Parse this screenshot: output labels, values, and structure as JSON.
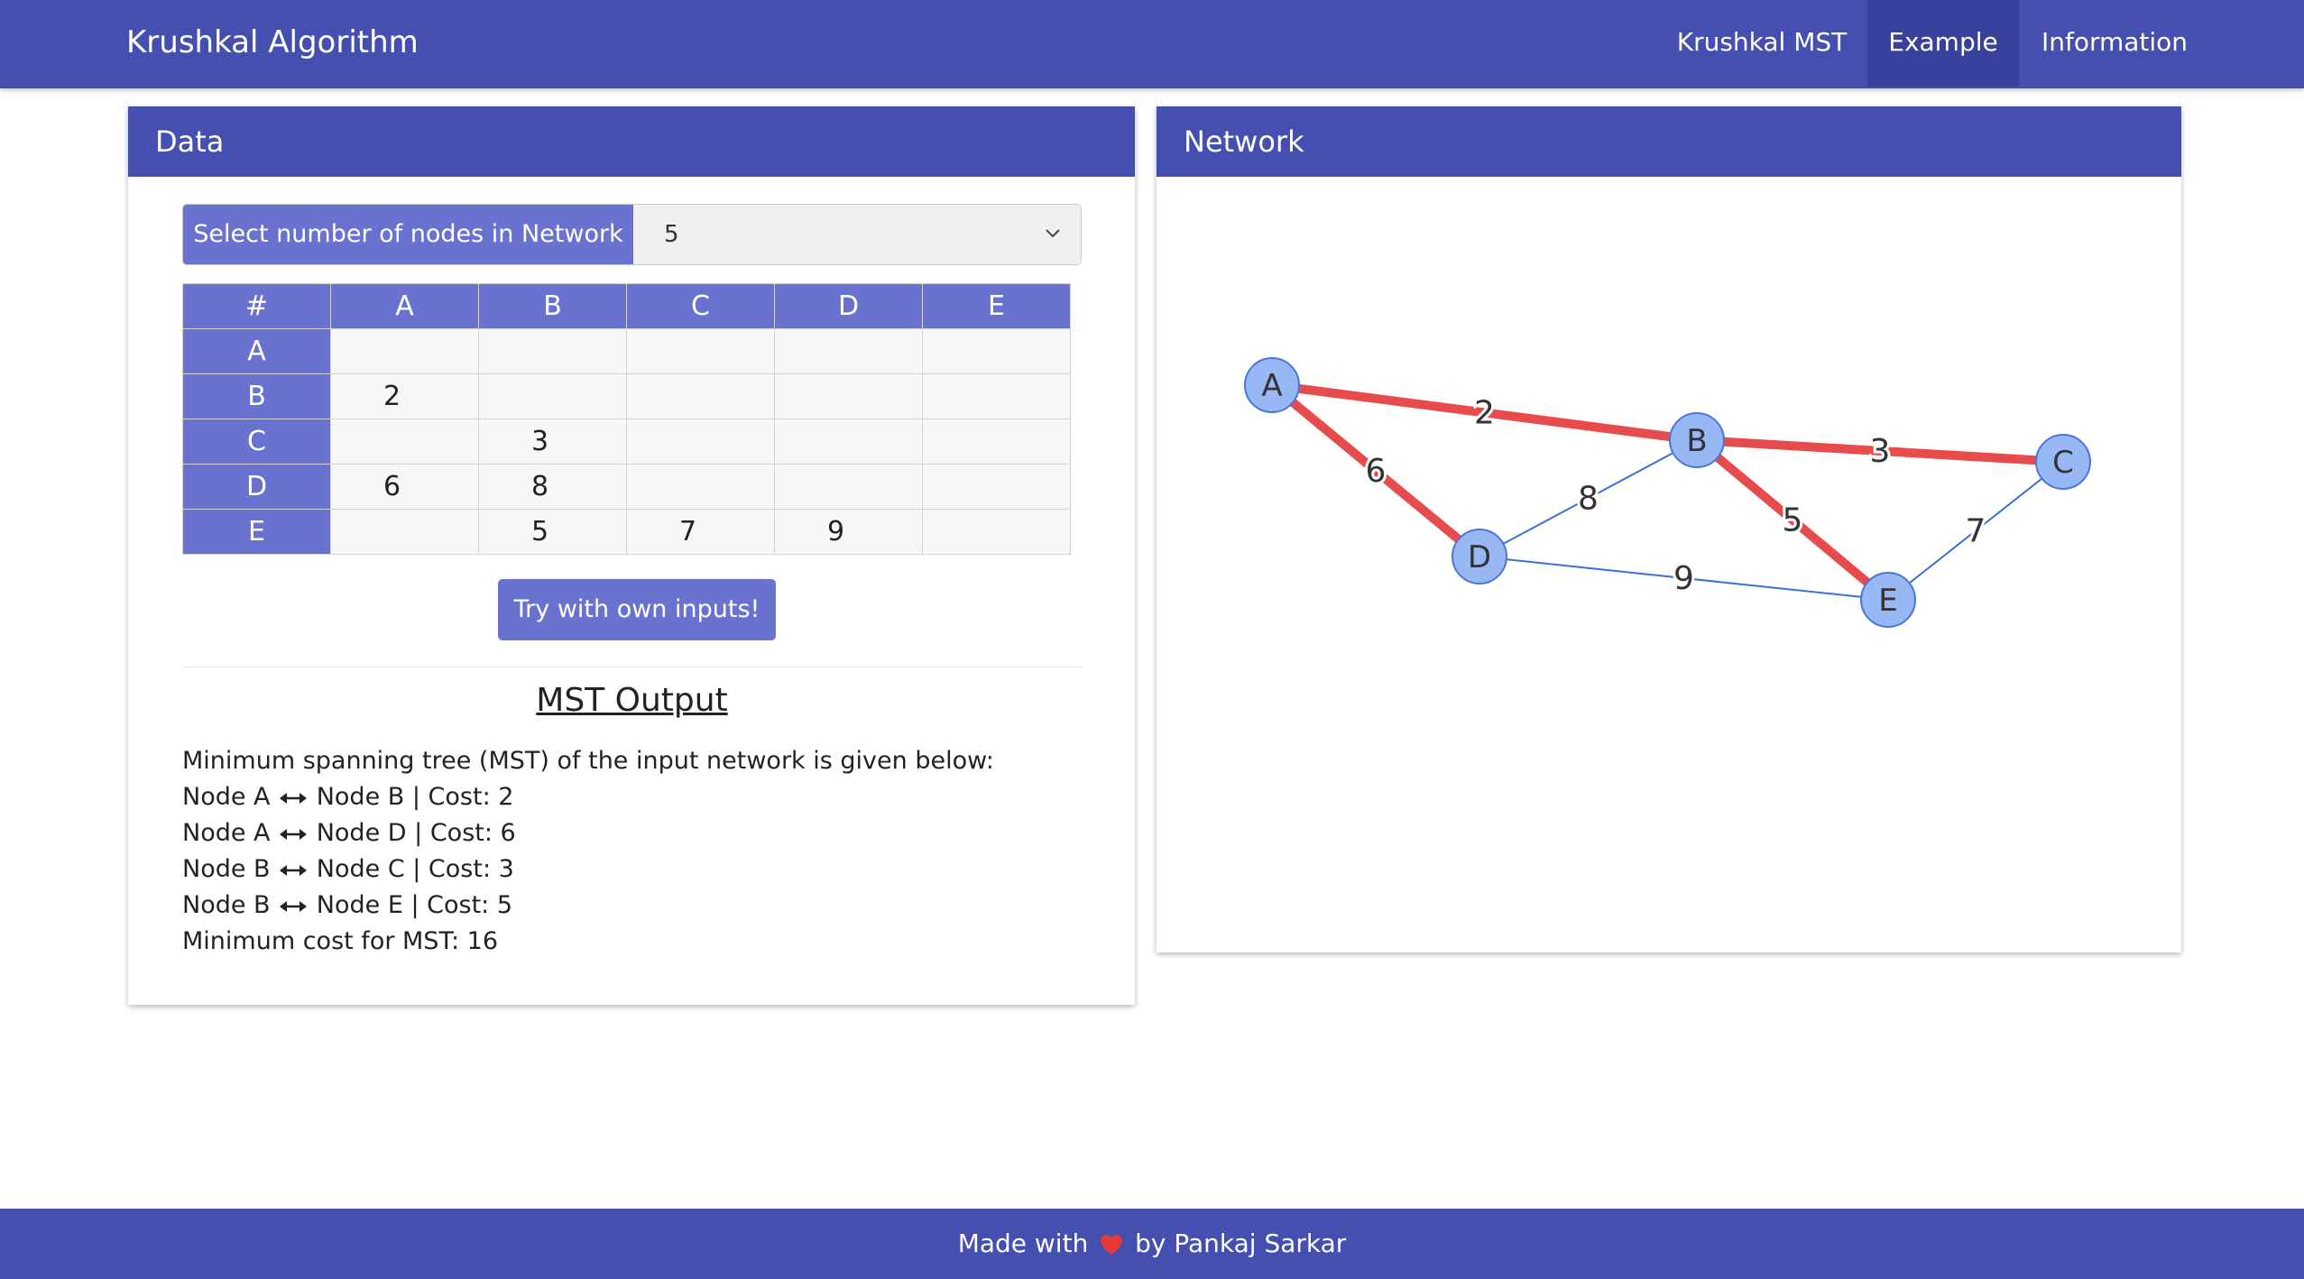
{
  "navbar": {
    "brand": "Krushkal Algorithm",
    "links": [
      {
        "label": "Krushkal MST",
        "active": false
      },
      {
        "label": "Example",
        "active": true
      },
      {
        "label": "Information",
        "active": false
      }
    ]
  },
  "data_card": {
    "title": "Data",
    "select_label": "Select number of nodes in Network",
    "select_value": "5",
    "matrix": {
      "corner": "#",
      "headers": [
        "A",
        "B",
        "C",
        "D",
        "E"
      ],
      "rows": [
        {
          "label": "A",
          "cells": [
            "",
            "",
            "",
            "",
            ""
          ]
        },
        {
          "label": "B",
          "cells": [
            "2",
            "",
            "",
            "",
            ""
          ]
        },
        {
          "label": "C",
          "cells": [
            "",
            "3",
            "",
            "",
            ""
          ]
        },
        {
          "label": "D",
          "cells": [
            "6",
            "8",
            "",
            "",
            ""
          ]
        },
        {
          "label": "E",
          "cells": [
            "",
            "5",
            "7",
            "9",
            ""
          ]
        }
      ]
    },
    "try_button": "Try with own inputs!",
    "mst_title": "MST Output",
    "mst_intro": "Minimum spanning tree (MST) of the input network is given below:",
    "mst_edges": [
      {
        "from": "Node A",
        "to": "Node B | Cost: 2"
      },
      {
        "from": "Node A",
        "to": "Node D | Cost: 6"
      },
      {
        "from": "Node B",
        "to": "Node C | Cost: 3"
      },
      {
        "from": "Node B",
        "to": "Node E | Cost: 5"
      }
    ],
    "mst_total": "Minimum cost for MST: 16"
  },
  "network_card": {
    "title": "Network",
    "nodes": [
      "A",
      "B",
      "C",
      "D",
      "E"
    ],
    "edges": [
      {
        "from": "A",
        "to": "B",
        "weight": "2",
        "in_mst": true
      },
      {
        "from": "A",
        "to": "D",
        "weight": "6",
        "in_mst": true
      },
      {
        "from": "B",
        "to": "C",
        "weight": "3",
        "in_mst": true
      },
      {
        "from": "B",
        "to": "E",
        "weight": "5",
        "in_mst": true
      },
      {
        "from": "B",
        "to": "D",
        "weight": "8",
        "in_mst": false
      },
      {
        "from": "C",
        "to": "E",
        "weight": "7",
        "in_mst": false
      },
      {
        "from": "D",
        "to": "E",
        "weight": "9",
        "in_mst": false
      }
    ]
  },
  "colors": {
    "primary": "#444fb0",
    "accent": "#6a72d0",
    "mst_edge": "#e84b4b",
    "other_edge": "#3b6fd6",
    "node_fill": "#97b7f5",
    "node_stroke": "#4a76d8",
    "heart": "#e53935"
  },
  "footer": {
    "before": "Made with",
    "icon": "heart-icon",
    "after": "by Pankaj Sarkar"
  }
}
